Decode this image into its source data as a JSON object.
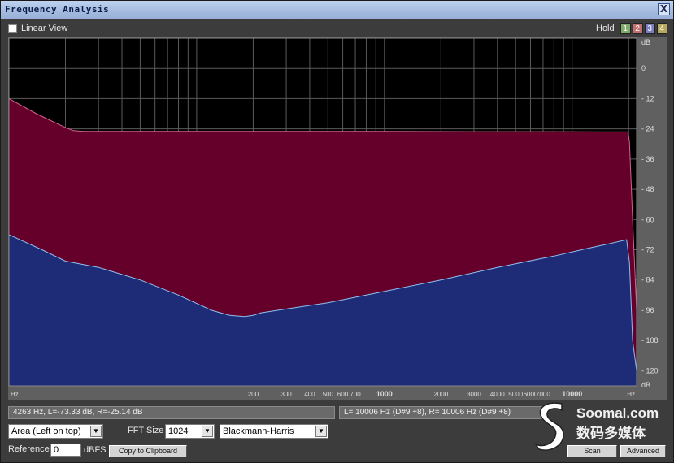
{
  "window": {
    "title": "Frequency Analysis",
    "close_label": "X"
  },
  "options": {
    "linear_view_label": "Linear View",
    "linear_view_checked": false
  },
  "hold": {
    "label": "Hold",
    "buttons": [
      {
        "label": "1",
        "color": "#7fa86a"
      },
      {
        "label": "2",
        "color": "#c07070"
      },
      {
        "label": "3",
        "color": "#7f7fc0"
      },
      {
        "label": "4",
        "color": "#b8a860"
      }
    ]
  },
  "chart_data": {
    "type": "area",
    "x_scale": "log",
    "xlim": [
      10,
      22050
    ],
    "ylim": [
      -126,
      12
    ],
    "x_unit_label": "Hz",
    "y_unit_label": "dB",
    "x_ticks": [
      {
        "label": "200",
        "value": 200
      },
      {
        "label": "300",
        "value": 300
      },
      {
        "label": "400",
        "value": 400
      },
      {
        "label": "500",
        "value": 500
      },
      {
        "label": "600",
        "value": 600
      },
      {
        "label": "700",
        "value": 700
      },
      {
        "label": "1000",
        "value": 1000
      },
      {
        "label": "2000",
        "value": 2000
      },
      {
        "label": "3000",
        "value": 3000
      },
      {
        "label": "4000",
        "value": 4000
      },
      {
        "label": "5000",
        "value": 5000
      },
      {
        "label": "6000",
        "value": 6000
      },
      {
        "label": "7000",
        "value": 7000
      },
      {
        "label": "10000",
        "value": 10000
      }
    ],
    "y_ticks": [
      0,
      -12,
      -24,
      -36,
      -48,
      -60,
      -72,
      -84,
      -96,
      -108,
      -120
    ],
    "series": [
      {
        "name": "R",
        "color": "#64002a",
        "line_color": "#d86090",
        "x": [
          10,
          14,
          20,
          22,
          25,
          30,
          50,
          100,
          300,
          1000,
          3000,
          8000,
          15000,
          19800,
          20200,
          21000,
          22050
        ],
        "y": [
          -12,
          -18,
          -23.5,
          -24.7,
          -25,
          -25,
          -25,
          -25,
          -25,
          -25,
          -25.1,
          -25.1,
          -25.2,
          -25.2,
          -29,
          -60,
          -96
        ]
      },
      {
        "name": "L",
        "color": "#1e2c78",
        "line_color": "#8cc0f0",
        "x": [
          10,
          15,
          20,
          30,
          50,
          80,
          120,
          150,
          180,
          200,
          220,
          300,
          500,
          1000,
          2000,
          4000,
          8000,
          12000,
          16000,
          19500,
          20200,
          21000,
          22050
        ],
        "y": [
          -66,
          -72,
          -76.5,
          -79,
          -84,
          -90,
          -96,
          -98,
          -98.5,
          -98,
          -97,
          -95.5,
          -93,
          -88.5,
          -84,
          -79,
          -74.5,
          -71.5,
          -69.5,
          -68,
          -77,
          -108,
          -120
        ]
      }
    ]
  },
  "status": {
    "left": "4263 Hz, L=-73.33 dB, R=-25.14 dB",
    "right": "L=  10006 Hz (D#9 +8), R=  10006 Hz (D#9 +8)"
  },
  "controls": {
    "view_mode": "Area (Left on top)",
    "fft_size_label": "FFT Size",
    "fft_size": "1024",
    "window_fn": "Blackmann-Harris",
    "reference_label": "Reference",
    "reference_value": "0",
    "reference_unit": "dBFS",
    "copy_label": "Copy to Clipboard",
    "scan_label": "Scan",
    "advanced_label": "Advanced"
  },
  "watermark": {
    "brand": "Soomal.com",
    "tagline": "数码多媒体"
  }
}
